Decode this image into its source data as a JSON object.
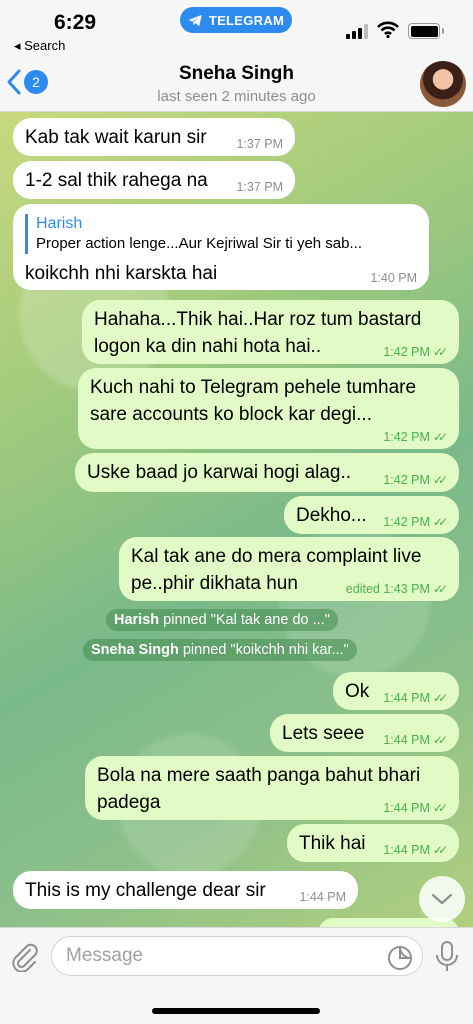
{
  "status_bar": {
    "time": "6:29",
    "back_app": "◂ Search",
    "app_pill": "TELEGRAM"
  },
  "header": {
    "unread_count": "2",
    "contact_name": "Sneha Singh",
    "last_seen": "last seen 2 minutes ago"
  },
  "messages": [
    {
      "dir": "in",
      "text": "Kab tak wait karun sir",
      "time": "1:37 PM"
    },
    {
      "dir": "in",
      "text": "1-2 sal thik rahega na",
      "time": "1:37 PM"
    },
    {
      "dir": "in",
      "reply_name": "Harish",
      "reply_text": "Proper action lenge...Aur Kejriwal Sir ti yeh sab...",
      "text": "koikchh nhi karskta hai",
      "time": "1:40 PM"
    },
    {
      "dir": "out",
      "text": "Hahaha...Thik hai..Har roz tum bastard logon ka din nahi hota hai..",
      "time": "1:42 PM"
    },
    {
      "dir": "out",
      "text": "Kuch nahi to Telegram pehele tumhare sare accounts ko block kar degi...",
      "time": "1:42 PM"
    },
    {
      "dir": "out",
      "text": "Uske baad jo karwai hogi alag..",
      "time": "1:42 PM"
    },
    {
      "dir": "out",
      "text": "Dekho...",
      "time": "1:42 PM"
    },
    {
      "dir": "out",
      "text": "Kal tak ane do mera complaint live pe..phir dikhata hun",
      "time": "edited 1:43 PM"
    },
    {
      "dir": "out",
      "text": "Ok",
      "time": "1:44 PM"
    },
    {
      "dir": "out",
      "text": "Lets seee",
      "time": "1:44 PM"
    },
    {
      "dir": "out",
      "text": "Bola na mere saath panga bahut bhari padega",
      "time": "1:44 PM"
    },
    {
      "dir": "out",
      "text": "Thik hai",
      "time": "1:44 PM"
    },
    {
      "dir": "in",
      "text": "This is my challenge dear sir",
      "time": "1:44 PM"
    }
  ],
  "service_messages": [
    {
      "actor": "Harish",
      "text": "pinned \"Kal tak ane do ...\""
    },
    {
      "actor": "Sneha Singh",
      "text": "pinned \"koikchh nhi kar...\""
    }
  ],
  "input": {
    "placeholder": "Message"
  },
  "icons": {
    "app_pill": "telegram-plane-icon",
    "back": "chevron-left-icon",
    "attach": "paperclip-icon",
    "sticker": "sticker-icon",
    "mic": "microphone-icon",
    "scroll": "chevron-down-icon",
    "read": "double-check-icon"
  },
  "colors": {
    "accent": "#2d8bf0",
    "outgoing_bubble": "#e2fbc6",
    "incoming_bubble": "#ffffff",
    "outgoing_meta": "#4caf50"
  }
}
